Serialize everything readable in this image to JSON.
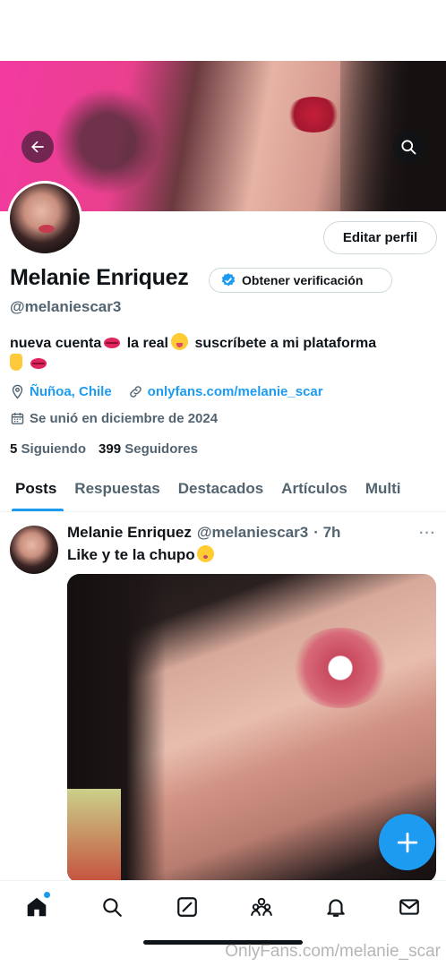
{
  "colors": {
    "accent": "#1d9bf0",
    "text": "#0f1419",
    "muted": "#536471",
    "border": "#cfd9de"
  },
  "header": {
    "back_icon": "arrow-left-icon",
    "search_icon": "search-icon"
  },
  "profile": {
    "edit_label": "Editar perfil",
    "name": "Melanie Enriquez",
    "verify_label": "Obtener verificación",
    "handle": "@melaniescar3",
    "bio_part1": "nueva cuenta",
    "bio_part2": "la real",
    "bio_part3": "suscríbete a mi plataforma",
    "location": "Ñuñoa, Chile",
    "link": "onlyfans.com/melanie_scar",
    "joined": "Se unió en diciembre de 2024",
    "following_count": "5",
    "following_label": "Siguiendo",
    "followers_count": "399",
    "followers_label": "Seguidores"
  },
  "tabs": [
    {
      "label": "Posts",
      "active": true
    },
    {
      "label": "Respuestas",
      "active": false
    },
    {
      "label": "Destacados",
      "active": false
    },
    {
      "label": "Artículos",
      "active": false
    },
    {
      "label": "Multi",
      "active": false
    }
  ],
  "post": {
    "author": "Melanie Enriquez",
    "handle": "@melaniescar3",
    "time": "· 7h",
    "more": "···",
    "text": "Like y te la chupo"
  },
  "navbar": {
    "items": [
      "home-icon",
      "search-icon",
      "grok-icon",
      "communities-icon",
      "notifications-icon",
      "messages-icon"
    ]
  },
  "watermark": "OnlyFans.com/melanie_scar"
}
